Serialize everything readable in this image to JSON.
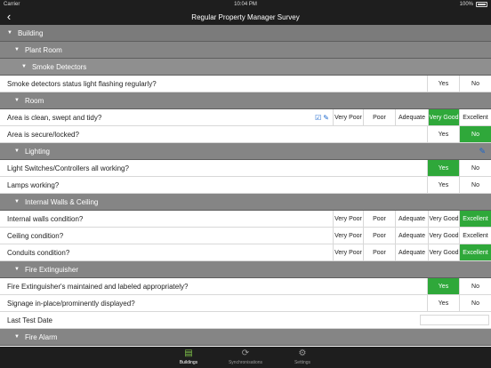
{
  "status": {
    "carrier": "Carrier",
    "time": "10:04 PM",
    "battery": "100%"
  },
  "nav": {
    "title": "Regular Property Manager Survey",
    "back_icon": "chevron-left-icon"
  },
  "sections": {
    "building": "Building",
    "plant_room": "Plant Room",
    "smoke_detectors": "Smoke Detectors",
    "room": "Room",
    "lighting": "Lighting",
    "internal_walls": "Internal Walls & Ceiling",
    "fire_extinguisher": "Fire Extinguisher",
    "fire_alarm": "Fire Alarm"
  },
  "options": {
    "yes": "Yes",
    "no": "No",
    "very_poor": "Very Poor",
    "poor": "Poor",
    "adequate": "Adequate",
    "very_good": "Very Good",
    "excellent": "Excellent"
  },
  "questions": {
    "smoke_status": "Smoke detectors status light flashing regularly?",
    "area_clean": "Area is clean, swept and tidy?",
    "area_secure": "Area is secure/locked?",
    "light_switches": "Light Switches/Controllers all working?",
    "lamps": "Lamps working?",
    "internal_walls": "Internal walls condition?",
    "ceiling": "Ceiling condition?",
    "conduits": "Conduits condition?",
    "extinguisher_maintained": "Fire Extinguisher's maintained and labeled appropriately?",
    "signage": "Signage in-place/prominently displayed?",
    "last_test": "Last Test Date"
  },
  "selected": {
    "smoke_status": "",
    "area_clean": "Very Good",
    "area_secure": "No",
    "light_switches": "Yes",
    "lamps": "",
    "internal_walls": "Excellent",
    "ceiling": "",
    "conduits": "Excellent",
    "extinguisher_maintained": "Yes",
    "signage": ""
  },
  "colors": {
    "selected": "#2fa83a",
    "bar": "#1e1e1e",
    "section": "#858585"
  },
  "tabs": [
    {
      "label": "Buildings",
      "icon": "building-icon",
      "active": true
    },
    {
      "label": "Synchronisations",
      "icon": "sync-icon",
      "active": false
    },
    {
      "label": "Settings",
      "icon": "gear-icon",
      "active": false
    }
  ]
}
